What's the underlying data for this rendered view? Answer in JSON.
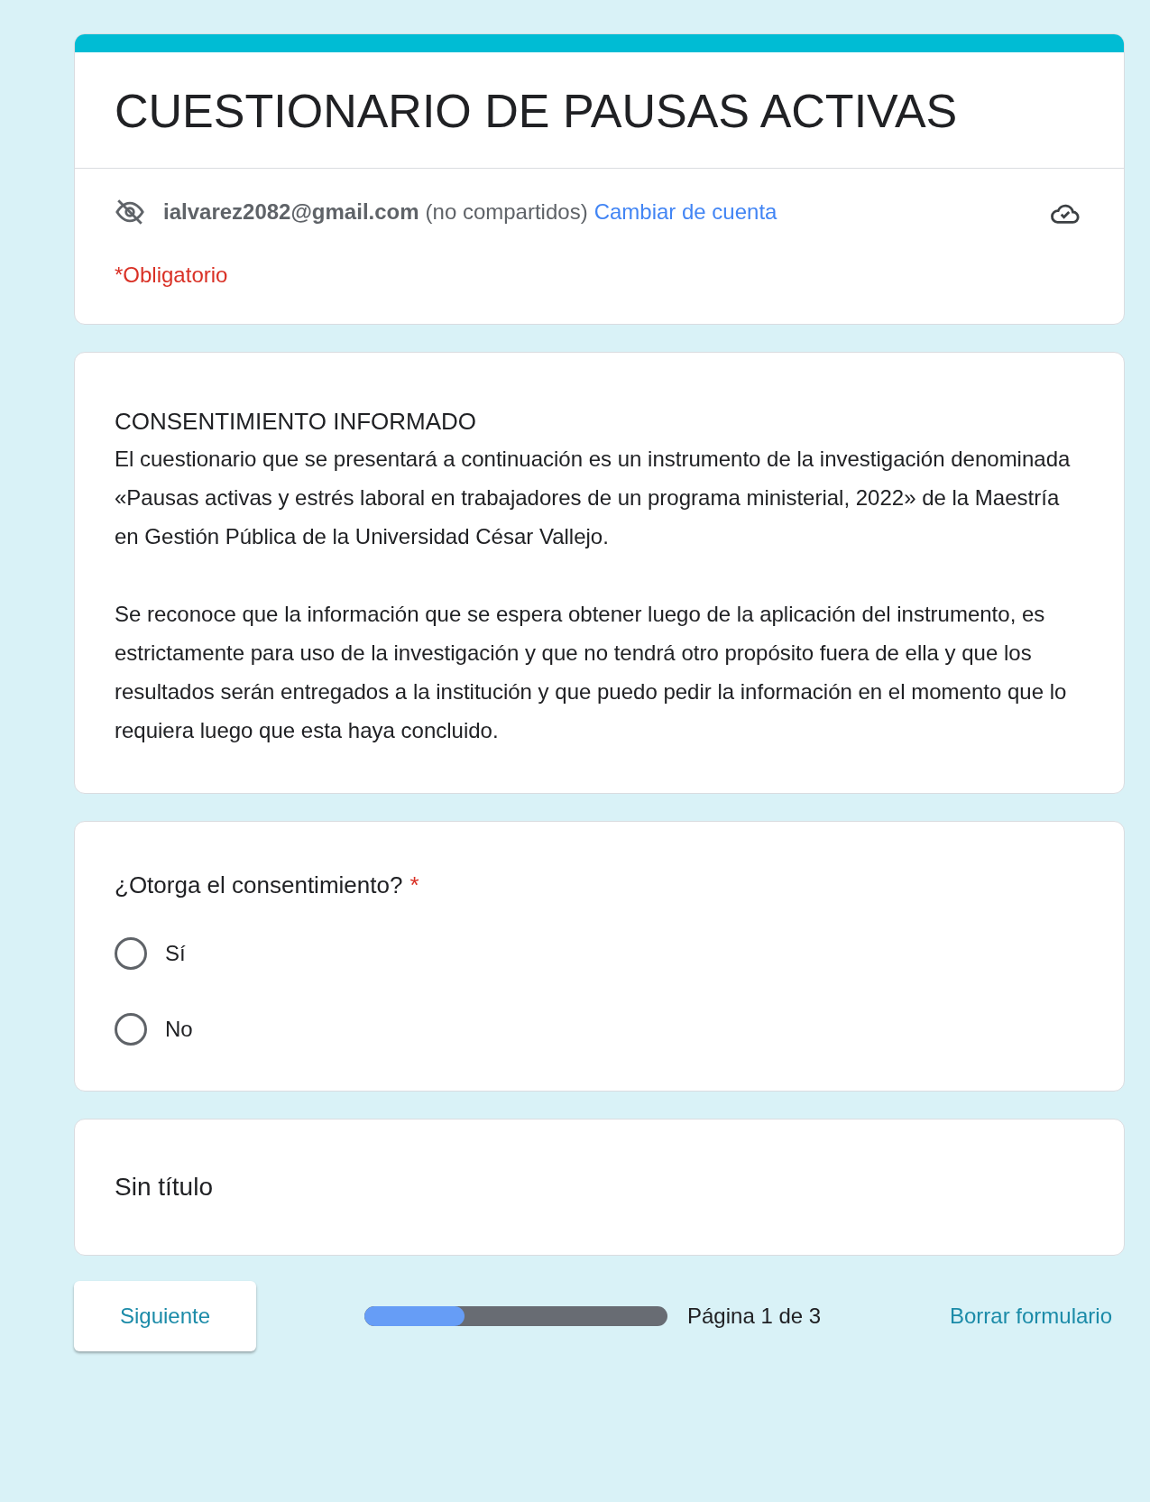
{
  "form": {
    "title": "CUESTIONARIO DE PAUSAS ACTIVAS",
    "account": {
      "email": "ialvarez2082@gmail.com",
      "note": "(no compartidos)",
      "switch_link": "Cambiar de cuenta"
    },
    "required_note": "*Obligatorio"
  },
  "section": {
    "heading": "CONSENTIMIENTO INFORMADO",
    "paragraphs": [
      "El cuestionario que se presentará a continuación es un instrumento de la investigación denominada «Pausas activas y estrés laboral en trabajadores de un programa ministerial, 2022» de la Maestría en Gestión Pública de la Universidad César Vallejo.",
      "Se reconoce que la información que se espera obtener luego de la aplicación del instrumento, es estrictamente para uso de la investigación y que no tendrá otro propósito fuera de ella y que los resultados serán entregados a la institución y que puedo pedir la información en el momento que lo requiera luego que esta haya concluido."
    ]
  },
  "question": {
    "text": "¿Otorga el consentimiento?",
    "required_mark": "*",
    "options": [
      {
        "label": "Sí",
        "selected": false
      },
      {
        "label": "No",
        "selected": false
      }
    ]
  },
  "untitled_section": {
    "title": "Sin título"
  },
  "footer": {
    "next_button": "Siguiente",
    "progress": {
      "level": 0.33,
      "label": "Página 1 de 3"
    },
    "clear_link": "Borrar formulario"
  }
}
